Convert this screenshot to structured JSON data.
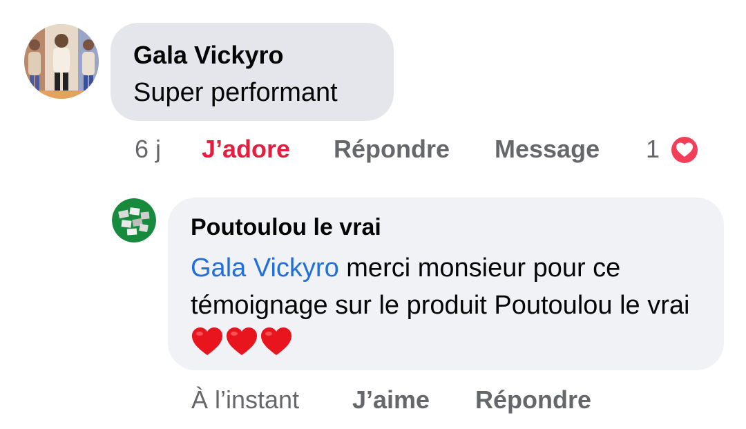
{
  "comment": {
    "author": "Gala Vickyro",
    "text": "Super performant",
    "time": "6 j",
    "like_label": "J’adore",
    "reply_label": "Répondre",
    "message_label": "Message",
    "reaction_count": "1",
    "reaction_icon": "heart-icon",
    "like_color": "#e41e3f"
  },
  "reply": {
    "author": "Poutoulou le vrai",
    "mention": "Gala Vickyro",
    "text": " merci monsieur pour ce témoignage sur le produit Poutoulou le vrai ",
    "emoji_icons": [
      "heart-emoji-icon",
      "heart-emoji-icon",
      "heart-emoji-icon"
    ],
    "time": "À l’instant",
    "like_label": "J’aime",
    "reply_label": "Répondre",
    "mention_color": "#216fdb"
  }
}
